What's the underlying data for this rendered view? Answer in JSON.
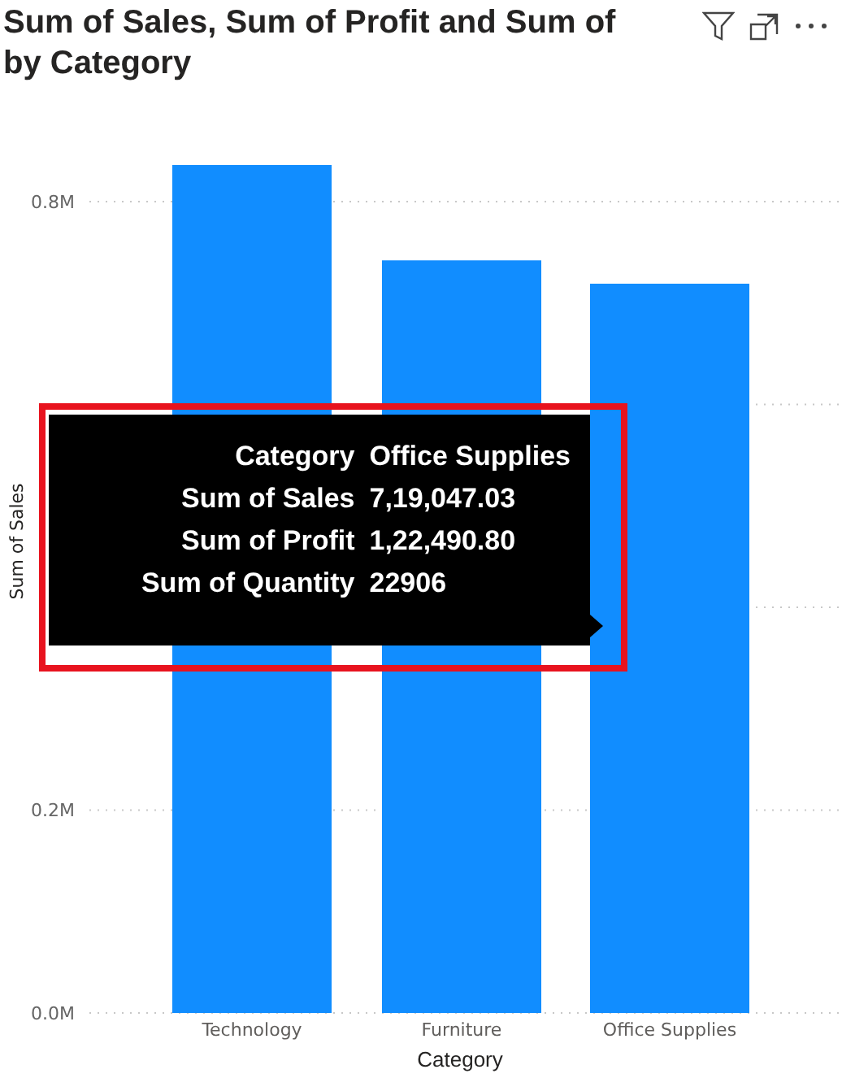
{
  "header": {
    "title_lines": [
      "Sum of Sales, Sum of Profit and Sum of",
      "by Category"
    ]
  },
  "chart": {
    "chart_data": {
      "type": "bar",
      "xlabel": "Category",
      "ylabel": "Sum of Sales",
      "categories": [
        "Technology",
        "Furniture",
        "Office Supplies"
      ],
      "series": [
        {
          "color": "#118dff",
          "values": [
            836000,
            742000,
            719000
          ]
        }
      ],
      "grid": true,
      "ylim": [
        0,
        840000
      ],
      "yticks": [
        {
          "value": 0,
          "label": "0.0M"
        },
        {
          "value": 200000,
          "label": "0.2M"
        },
        {
          "value": 800000,
          "label": "0.8M"
        }
      ]
    }
  },
  "tooltip": {
    "rows": [
      {
        "label": "Category",
        "value": "Office Supplies"
      },
      {
        "label": "Sum of Sales",
        "value": "7,19,047.03"
      },
      {
        "label": "Sum of Profit",
        "value": "1,22,490.80"
      },
      {
        "label": "Sum of Quantity",
        "value": "22906"
      }
    ]
  }
}
